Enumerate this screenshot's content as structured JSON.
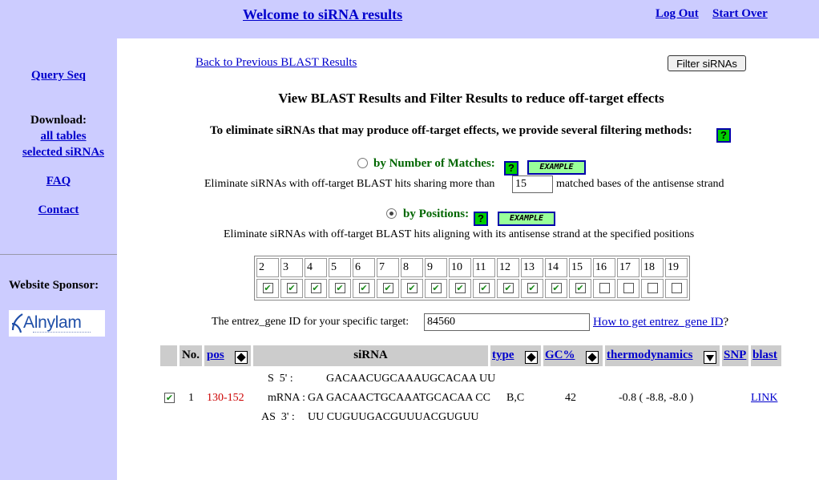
{
  "header": {
    "title": "Welcome to siRNA results",
    "logout": "Log Out",
    "start_over": "Start Over"
  },
  "sidebar": {
    "query_seq": "Query Seq",
    "download_label": "Download:",
    "all_tables": "all tables",
    "selected_sirnas": "selected siRNAs",
    "faq": "FAQ",
    "contact": "Contact",
    "sponsor_label": "Website Sponsor:",
    "sponsor_logo_text": "Alnylam"
  },
  "main": {
    "back_link": "Back to Previous BLAST Results",
    "filter_button": "Filter siRNAs",
    "heading": "View BLAST Results and Filter Results to reduce off-target effects",
    "intro": "To eliminate siRNAs that may produce off-target effects, we provide several filtering methods:",
    "help_glyph": "?",
    "example_label": "EXAMPLE",
    "by_matches": {
      "label": "by Number of Matches:",
      "selected": false,
      "text_before": "Eliminate siRNAs with off-target BLAST hits sharing more than",
      "value": "15",
      "text_after": "matched bases of the antisense strand"
    },
    "by_positions": {
      "label": "by Positions:",
      "selected": true,
      "text": "Eliminate siRNAs with off-target BLAST hits aligning with its antisense strand at the specified positions",
      "positions": [
        "2",
        "3",
        "4",
        "5",
        "6",
        "7",
        "8",
        "9",
        "10",
        "11",
        "12",
        "13",
        "14",
        "15",
        "16",
        "17",
        "18",
        "19"
      ],
      "checked": [
        true,
        true,
        true,
        true,
        true,
        true,
        true,
        true,
        true,
        true,
        true,
        true,
        true,
        true,
        false,
        false,
        false,
        false
      ]
    },
    "gene": {
      "label": "The entrez_gene ID for your specific target:",
      "value": "84560",
      "link": "How to get entrez_gene ID",
      "suffix": "?"
    }
  },
  "results": {
    "headers": {
      "no": "No.",
      "pos": "pos",
      "sirna": "siRNA",
      "type": "type",
      "gc": "GC%",
      "thermo": "thermodynamics",
      "snp": "SNP",
      "blast": "blast"
    },
    "rows": [
      {
        "selected": true,
        "no": "1",
        "pos": "130-152",
        "s_label": "S  5' :",
        "s_seq": "GACAACUGCAAAUGCACAA UU",
        "mrna_label": "mRNA :",
        "mrna_seq": "GA GACAACTGCAAATGCACAA CC",
        "as_label": "AS  3' :",
        "as_seq": "UU CUGUUGACGUUUACGUGUU",
        "type": "B,C",
        "gc": "42",
        "thermo": "-0.8 ( -8.8, -8.0 )",
        "blast": "LINK"
      }
    ]
  },
  "colors": {
    "background": "#ccccff",
    "link": "#0000cc",
    "option_label": "#006600",
    "pos_value": "#cc0000",
    "help_icon": "#00cc00",
    "example_button": "#99ff99"
  }
}
